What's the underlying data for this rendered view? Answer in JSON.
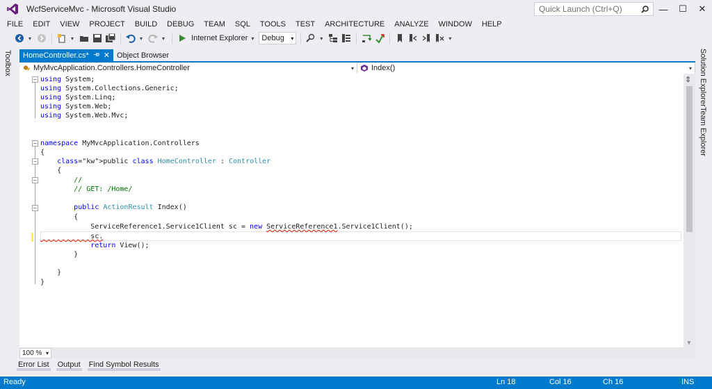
{
  "window": {
    "title": "WcfServiceMvc - Microsoft Visual Studio",
    "quick_launch_placeholder": "Quick Launch (Ctrl+Q)",
    "minimize": "—",
    "maximize": "☐",
    "close": "✕"
  },
  "menu": [
    "FILE",
    "EDIT",
    "VIEW",
    "PROJECT",
    "BUILD",
    "DEBUG",
    "TEAM",
    "SQL",
    "TOOLS",
    "TEST",
    "ARCHITECTURE",
    "ANALYZE",
    "WINDOW",
    "HELP"
  ],
  "toolbar": {
    "run_target": "Internet Explorer",
    "configuration": "Debug"
  },
  "side_panels": {
    "left": "Toolbox",
    "right_top": "Solution Explorer",
    "right_bottom": "Team Explorer"
  },
  "tabs": [
    {
      "label": "HomeController.cs*",
      "active": true
    },
    {
      "label": "Object Browser",
      "active": false
    }
  ],
  "navigation": {
    "type_scope": "MyMvcApplication.Controllers.HomeController",
    "member_scope": "Index()"
  },
  "code_lines": [
    "using System;",
    "using System.Collections.Generic;",
    "using System.Linq;",
    "using System.Web;",
    "using System.Web.Mvc;",
    "",
    "",
    "namespace MyMvcApplication.Controllers",
    "{",
    "    public class HomeController : Controller",
    "    {",
    "        //",
    "        // GET: /Home/",
    "",
    "        public ActionResult Index()",
    "        {",
    "            ServiceReference1.Service1Client sc = new ServiceReference1.Service1Client();",
    "            sc.",
    "            return View();",
    "        }",
    "",
    "    }",
    "}"
  ],
  "zoom": "100 %",
  "bottom_tabs": [
    "Error List",
    "Output",
    "Find Symbol Results"
  ],
  "status": {
    "state": "Ready",
    "line": "Ln 18",
    "col": "Col 16",
    "ch": "Ch 16",
    "mode": "INS"
  }
}
